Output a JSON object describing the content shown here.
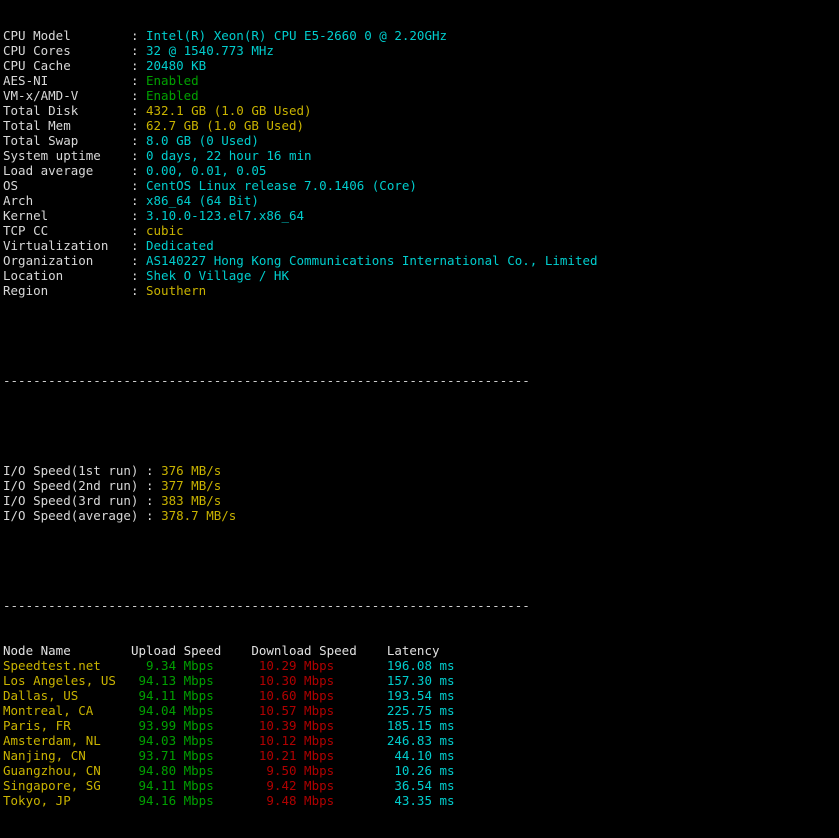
{
  "terminal": {
    "title": "bench.sh system benchmark output",
    "colors": {
      "background": "#000000",
      "label": "#d8d8d8",
      "cyan": "#00cdcd",
      "green": "#00a000",
      "yellow": "#c9b300",
      "red": "#b00000",
      "separator": "#cfcfcf"
    },
    "separator_1": "----------------------------------------------------------------------",
    "separator_2": "----------------------------------------------------------------------"
  },
  "sysinfo": {
    "rows": [
      {
        "label": "CPU Model",
        "sep": ":",
        "value": "Intel(R) Xeon(R) CPU E5-2660 0 @ 2.20GHz",
        "color": "cyan"
      },
      {
        "label": "CPU Cores",
        "sep": ":",
        "value": "32 @ 1540.773 MHz",
        "color": "cyan"
      },
      {
        "label": "CPU Cache",
        "sep": ":",
        "value": "20480 KB",
        "color": "cyan"
      },
      {
        "label": "AES-NI",
        "sep": ":",
        "value": "Enabled",
        "color": "green"
      },
      {
        "label": "VM-x/AMD-V",
        "sep": ":",
        "value": "Enabled",
        "color": "green"
      },
      {
        "label": "Total Disk",
        "sep": ":",
        "value": "432.1 GB (1.0 GB Used)",
        "color": "yellow"
      },
      {
        "label": "Total Mem",
        "sep": ":",
        "value": "62.7 GB (1.0 GB Used)",
        "color": "yellow"
      },
      {
        "label": "Total Swap",
        "sep": ":",
        "value": "8.0 GB (0 Used)",
        "color": "cyan"
      },
      {
        "label": "System uptime",
        "sep": ":",
        "value": "0 days, 22 hour 16 min",
        "color": "cyan"
      },
      {
        "label": "Load average",
        "sep": ":",
        "value": "0.00, 0.01, 0.05",
        "color": "cyan"
      },
      {
        "label": "OS",
        "sep": ":",
        "value": "CentOS Linux release 7.0.1406 (Core)",
        "color": "cyan"
      },
      {
        "label": "Arch",
        "sep": ":",
        "value": "x86_64 (64 Bit)",
        "color": "cyan"
      },
      {
        "label": "Kernel",
        "sep": ":",
        "value": "3.10.0-123.el7.x86_64",
        "color": "cyan"
      },
      {
        "label": "TCP CC",
        "sep": ":",
        "value": "cubic",
        "color": "yellow"
      },
      {
        "label": "Virtualization",
        "sep": ":",
        "value": "Dedicated",
        "color": "cyan"
      },
      {
        "label": "Organization",
        "sep": ":",
        "value": "AS140227 Hong Kong Communications International Co., Limited",
        "color": "cyan"
      },
      {
        "label": "Location",
        "sep": ":",
        "value": "Shek O Village / HK",
        "color": "cyan"
      },
      {
        "label": "Region",
        "sep": ":",
        "value": "Southern",
        "color": "yellow"
      }
    ]
  },
  "iospeed": {
    "rows": [
      {
        "label": "I/O Speed(1st run)",
        "sep": ":",
        "value": "376 MB/s",
        "color": "yellow"
      },
      {
        "label": "I/O Speed(2nd run)",
        "sep": ":",
        "value": "377 MB/s",
        "color": "yellow"
      },
      {
        "label": "I/O Speed(3rd run)",
        "sep": ":",
        "value": "383 MB/s",
        "color": "yellow"
      },
      {
        "label": "I/O Speed(average)",
        "sep": ":",
        "value": "378.7 MB/s",
        "color": "yellow"
      }
    ]
  },
  "speedtest": {
    "headers": {
      "node": "Node Name",
      "upload": "Upload Speed",
      "download": "Download Speed",
      "latency": "Latency"
    },
    "rows": [
      {
        "node": "Speedtest.net",
        "upload": "9.34 Mbps",
        "download": "10.29 Mbps",
        "latency": "196.08 ms"
      },
      {
        "node": "Los Angeles, US",
        "upload": "94.13 Mbps",
        "download": "10.30 Mbps",
        "latency": "157.30 ms"
      },
      {
        "node": "Dallas, US",
        "upload": "94.11 Mbps",
        "download": "10.60 Mbps",
        "latency": "193.54 ms"
      },
      {
        "node": "Montreal, CA",
        "upload": "94.04 Mbps",
        "download": "10.57 Mbps",
        "latency": "225.75 ms"
      },
      {
        "node": "Paris, FR",
        "upload": "93.99 Mbps",
        "download": "10.39 Mbps",
        "latency": "185.15 ms"
      },
      {
        "node": "Amsterdam, NL",
        "upload": "94.03 Mbps",
        "download": "10.12 Mbps",
        "latency": "246.83 ms"
      },
      {
        "node": "Nanjing, CN",
        "upload": "93.71 Mbps",
        "download": "10.21 Mbps",
        "latency": "44.10 ms"
      },
      {
        "node": "Guangzhou, CN",
        "upload": "94.80 Mbps",
        "download": "9.50 Mbps",
        "latency": "10.26 ms"
      },
      {
        "node": "Singapore, SG",
        "upload": "94.11 Mbps",
        "download": "9.42 Mbps",
        "latency": "36.54 ms"
      },
      {
        "node": "Tokyo, JP",
        "upload": "94.16 Mbps",
        "download": "9.48 Mbps",
        "latency": "43.35 ms"
      }
    ]
  }
}
